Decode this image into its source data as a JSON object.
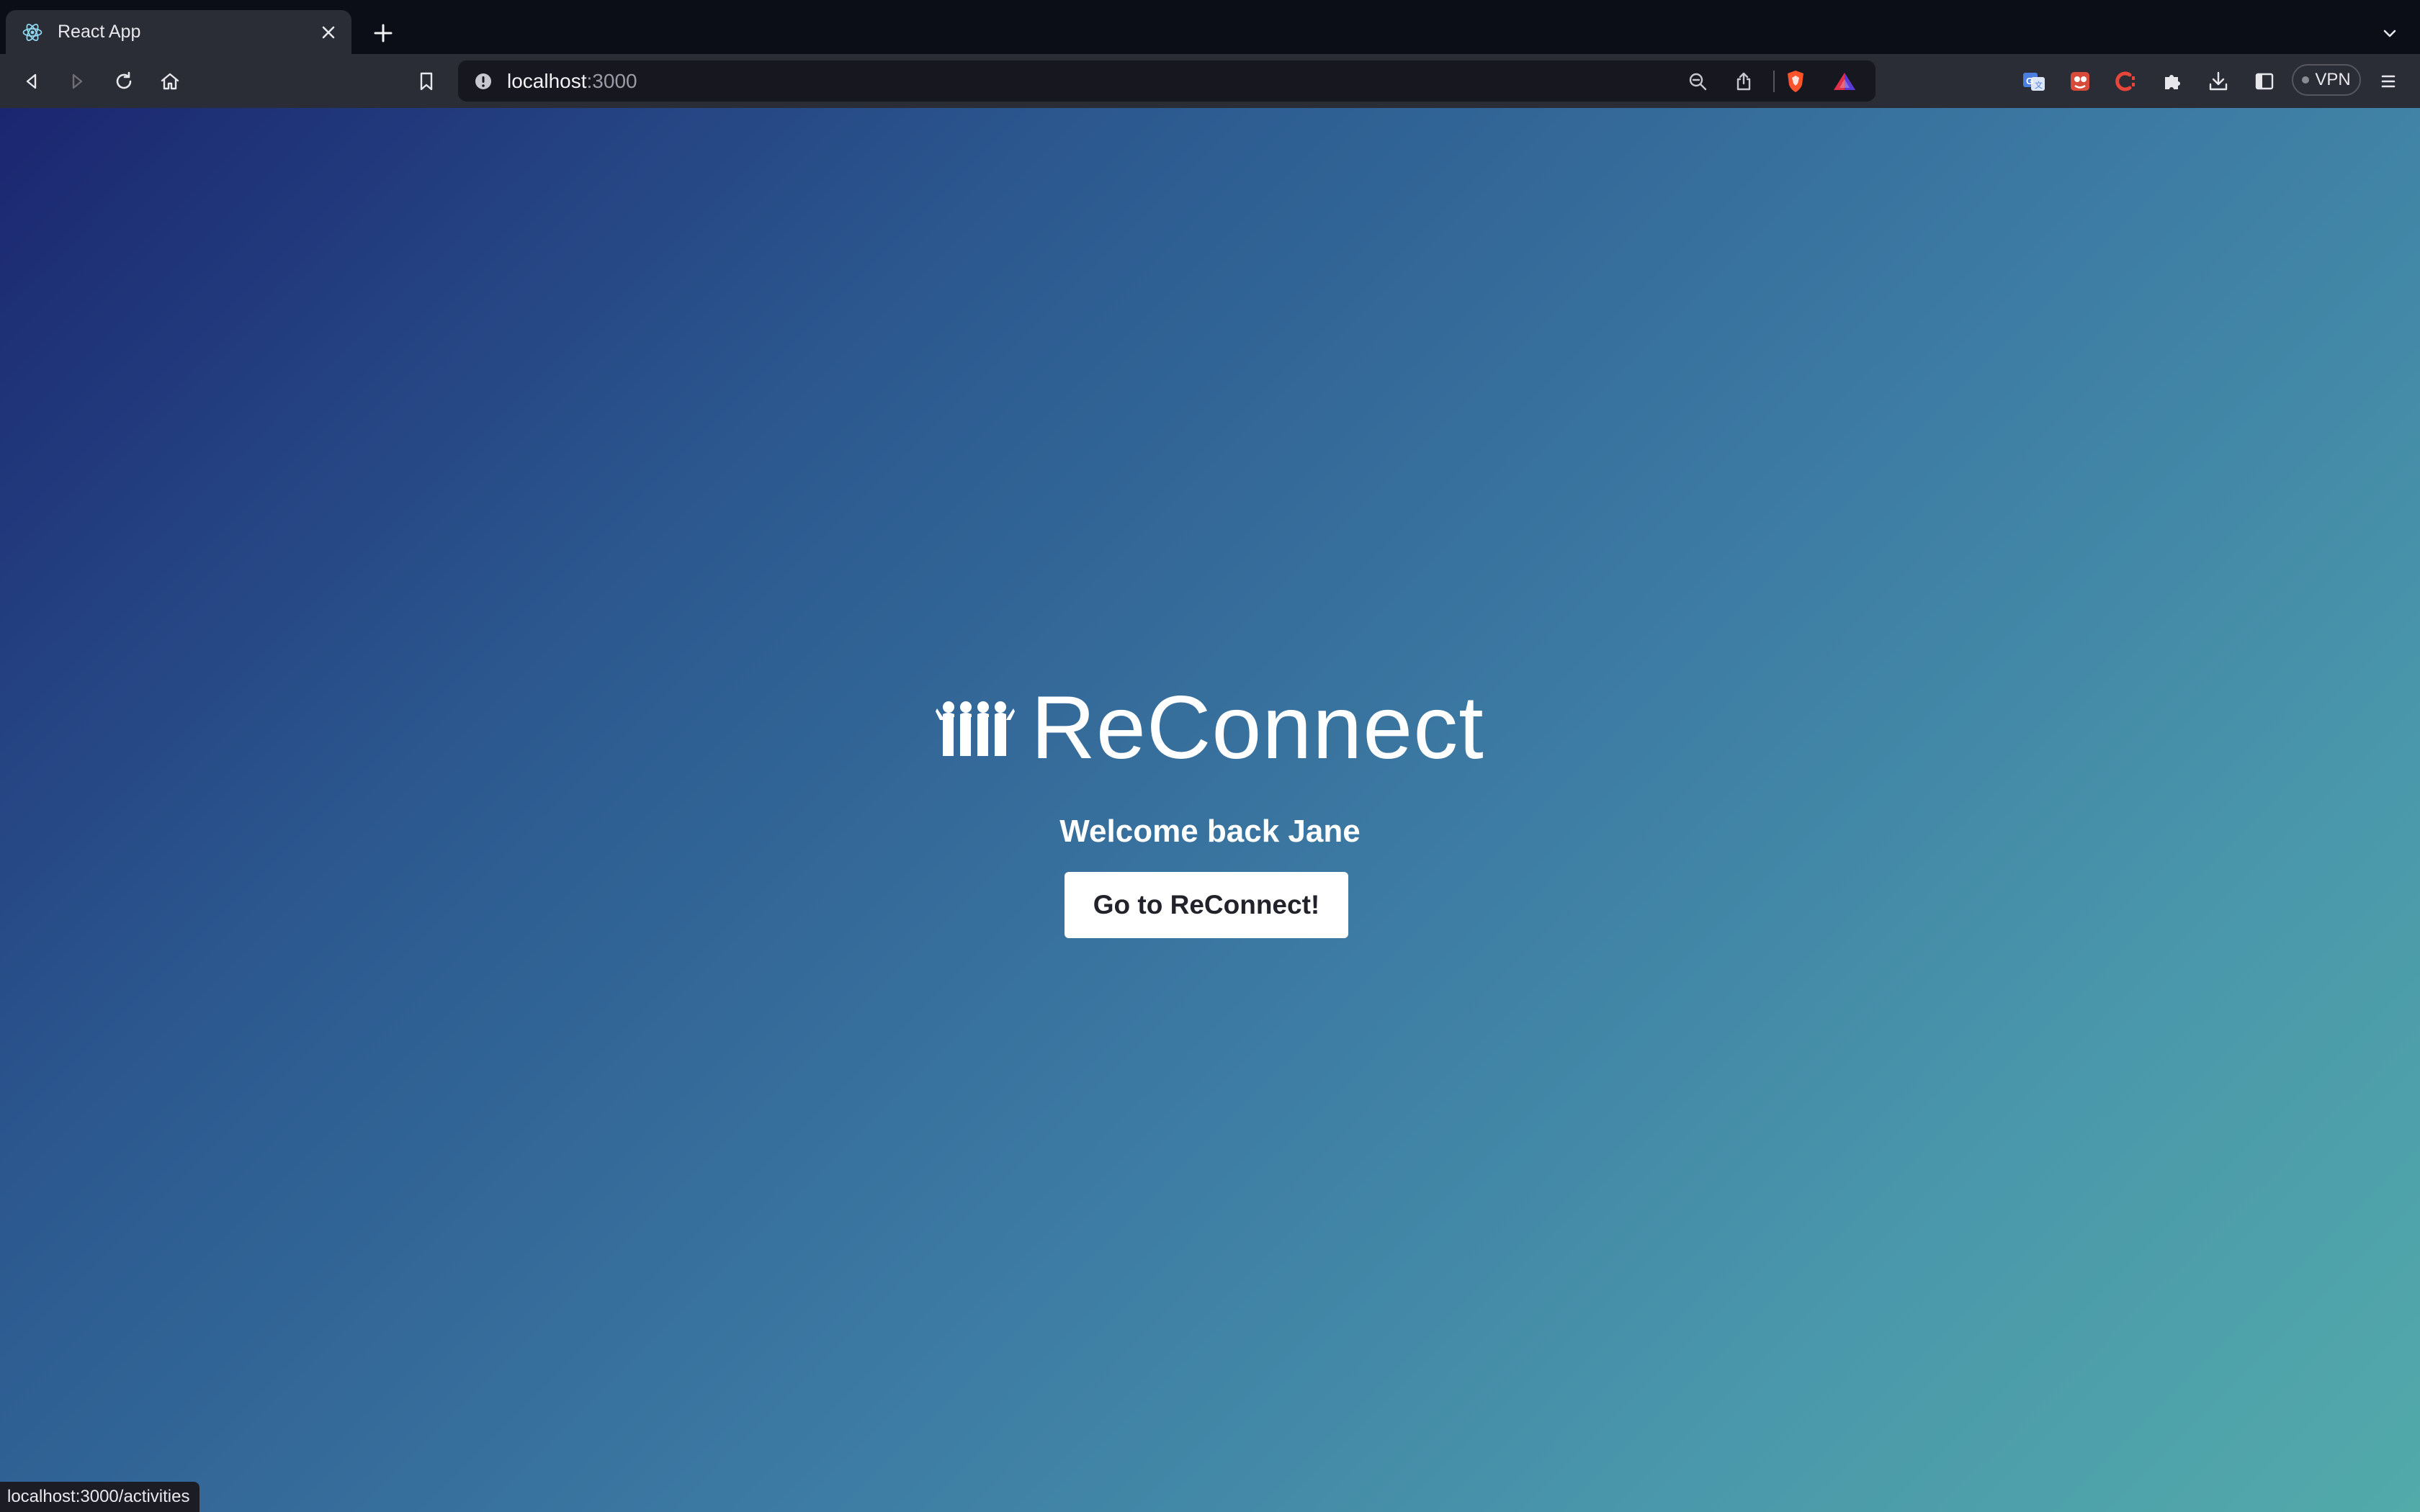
{
  "browser": {
    "tab": {
      "title": "React App",
      "favicon": "react-icon"
    },
    "new_tab_icon": "plus-icon",
    "tab_list_icon": "chevron-down-icon",
    "nav": {
      "back_icon": "back-arrow-icon",
      "forward_icon": "forward-arrow-icon",
      "reload_icon": "reload-icon",
      "home_icon": "home-icon",
      "bookmark_icon": "bookmark-icon"
    },
    "url": {
      "host": "localhost",
      "port": ":3000"
    },
    "url_icons": [
      "zoom-out-icon",
      "share-icon",
      "brave-shields-icon",
      "brave-rewards-icon"
    ],
    "extensions": [
      "translate-icon",
      "extension-icon",
      "colorzilla-icon",
      "puzzle-icon",
      "download-icon",
      "sidebar-icon"
    ],
    "vpn_label": "VPN",
    "menu_icon": "hamburger-menu-icon"
  },
  "page": {
    "logo_icon": "people-group-icon",
    "brand": "ReConnect",
    "welcome": "Welcome back Jane",
    "cta_label": "Go to ReConnect!",
    "colors": {
      "gradient_start": "#1b2670",
      "gradient_end": "#52aaa9",
      "button_bg": "#ffffff",
      "button_text": "#22232a"
    }
  },
  "status_bar": {
    "link": "localhost:3000/activities"
  }
}
